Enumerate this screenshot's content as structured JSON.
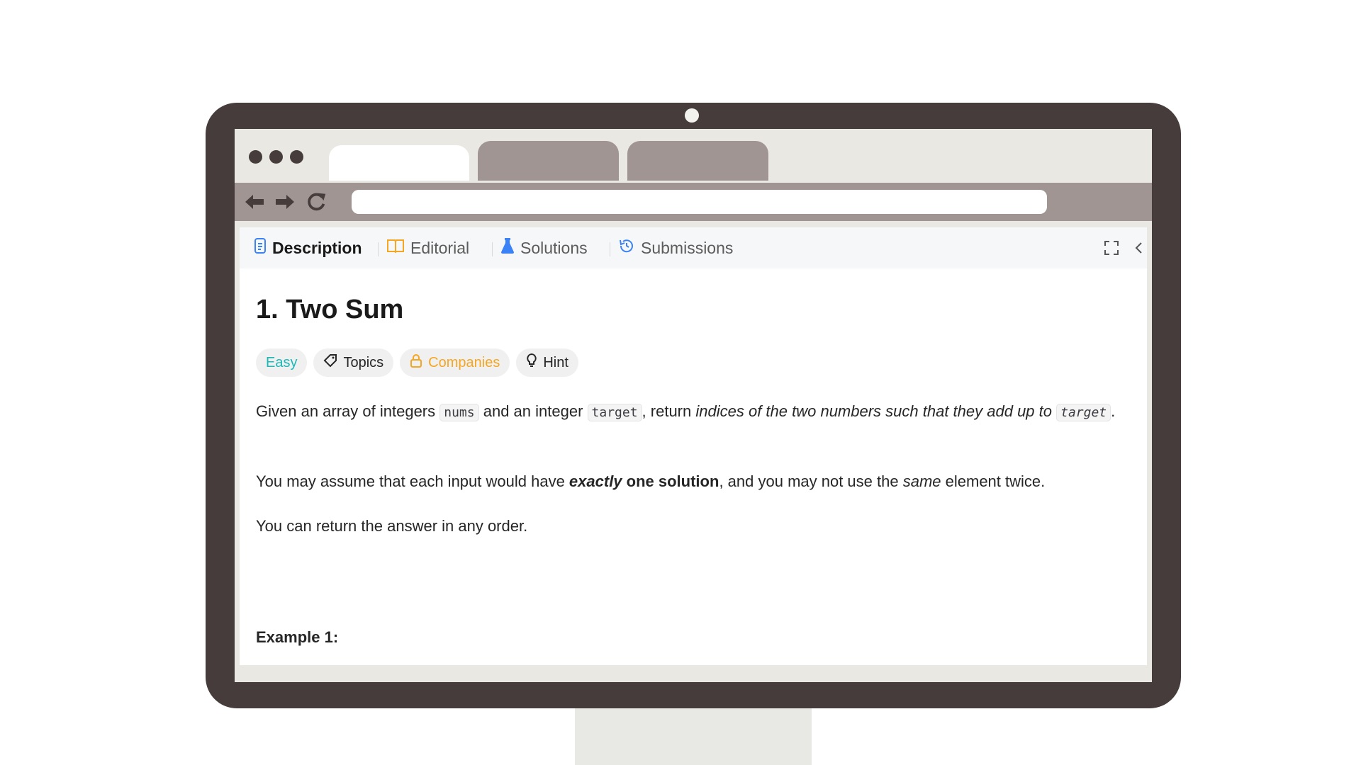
{
  "browser": {
    "tabs": [
      {
        "label": ""
      },
      {
        "label": ""
      },
      {
        "label": ""
      }
    ],
    "url": ""
  },
  "panel_tabs": [
    {
      "label": "Description",
      "icon": "document-icon"
    },
    {
      "label": "Editorial",
      "icon": "book-icon"
    },
    {
      "label": "Solutions",
      "icon": "flask-icon"
    },
    {
      "label": "Submissions",
      "icon": "history-icon"
    }
  ],
  "problem": {
    "title": "1. Two Sum",
    "chips": {
      "difficulty": "Easy",
      "topics": "Topics",
      "companies": "Companies",
      "hint": "Hint"
    },
    "p1": {
      "t1": "Given an array of integers ",
      "c1": "nums",
      "t2": " and an integer ",
      "c2": "target",
      "t3": ", return ",
      "em": "indices of the two numbers such that they add up to",
      "t4": " ",
      "c3": "target",
      "t5": "."
    },
    "p2": {
      "t1": "You may assume that each input would have ",
      "b1": "exactly",
      "b2": " one solution",
      "t2": ", and you may not use the ",
      "em": "same",
      "t3": " element twice."
    },
    "p3": "You can return the answer in any order.",
    "example_heading": "Example 1:"
  },
  "colors": {
    "easy": "#1cb8b8",
    "companies": "#f5a623",
    "monitor": "#453c3b",
    "chrome": "#a09592"
  }
}
